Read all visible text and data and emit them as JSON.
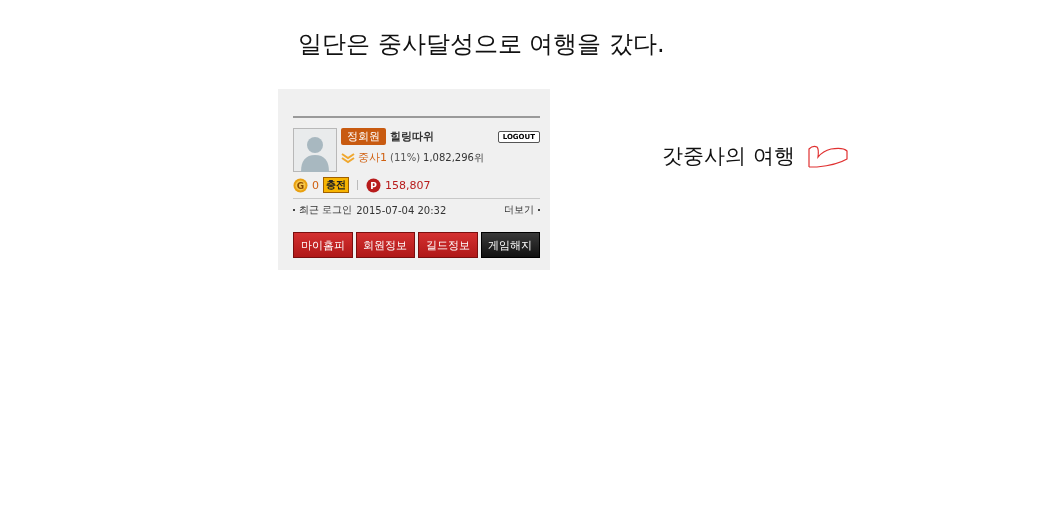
{
  "heading": "일단은 중사달성으로 여행을 갔다.",
  "profile": {
    "membership": "정회원",
    "nickname": "힐링따위",
    "logout": "LOGOUT",
    "rank": "중사1",
    "percent": "(11%)",
    "position": "1,082,296위",
    "coin_letter": "G",
    "gold": "0",
    "points_letter": "P",
    "charge": "충전",
    "points": "158,807",
    "last_login_label": "최근 로그인",
    "last_login": "2015-07-04 20:32",
    "more": "더보기",
    "buttons": [
      {
        "label": "마이홈피",
        "kind": "red"
      },
      {
        "label": "회원정보",
        "kind": "red"
      },
      {
        "label": "길드정보",
        "kind": "red"
      },
      {
        "label": "게임해지",
        "kind": "dark"
      }
    ]
  },
  "caption": "갓중사의 여행"
}
